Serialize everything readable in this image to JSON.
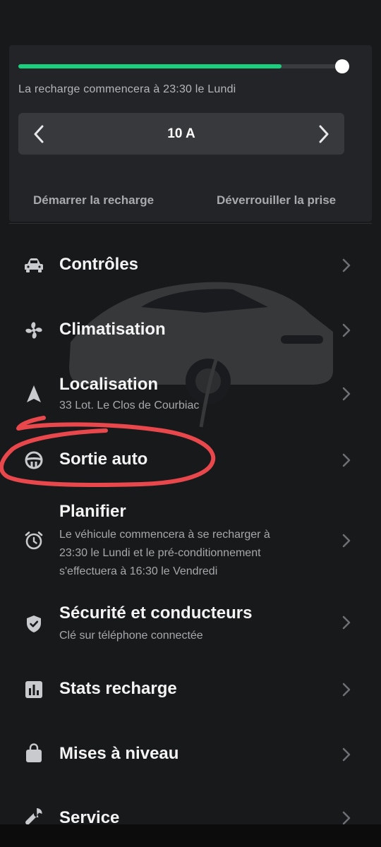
{
  "charge": {
    "progress_fraction": 0.81,
    "status_text": "La recharge commencera à 23:30 le Lundi",
    "amperage": "10 A",
    "start_label": "Démarrer la recharge",
    "unlock_label": "Déverrouiller la prise"
  },
  "menu": {
    "items": [
      {
        "title": "Contrôles",
        "icon": "car-icon"
      },
      {
        "title": "Climatisation",
        "icon": "fan-icon"
      },
      {
        "title": "Localisation",
        "subtitle": "33 Lot. Le Clos de Courbiac",
        "icon": "navigation-arrow-icon"
      },
      {
        "title": "Sortie auto",
        "icon": "steering-wheel-icon"
      },
      {
        "title": "Planifier",
        "subtitle_lines": [
          "Le véhicule commencera à se recharger à",
          "23:30 le Lundi et le pré-conditionnement",
          "s'effectuera à 16:30 le Vendredi"
        ],
        "icon": "alarm-clock-icon"
      },
      {
        "title": "Sécurité et conducteurs",
        "subtitle": "Clé sur téléphone connectée",
        "icon": "shield-check-icon"
      },
      {
        "title": "Stats recharge",
        "icon": "bar-chart-icon"
      },
      {
        "title": "Mises à niveau",
        "icon": "shopping-bag-icon"
      },
      {
        "title": "Service",
        "icon": "wrench-icon"
      }
    ]
  },
  "colors": {
    "background": "#18191b",
    "card": "#232427",
    "accent_green": "#19d07c",
    "annotation_red": "#e8474c"
  }
}
